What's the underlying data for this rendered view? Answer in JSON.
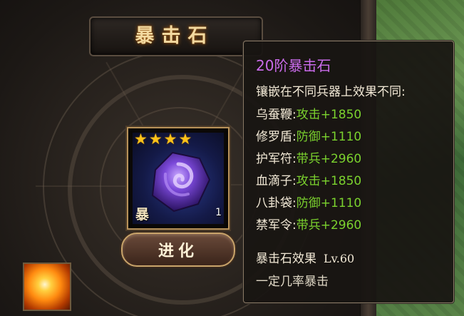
{
  "panel": {
    "title": "暴击石",
    "item": {
      "stars": 4,
      "corner_char": "暴",
      "count": "1",
      "gem_color": "#6a3ac8"
    },
    "evolve_button": "进化",
    "skill_icon": "explosion-icon"
  },
  "tooltip": {
    "title": "20阶暴击石",
    "intro": "镶嵌在不同兵器上效果不同:",
    "effects": [
      {
        "weapon": "乌蚕鞭",
        "stat": "攻击+1850"
      },
      {
        "weapon": "修罗盾",
        "stat": "防御+1110"
      },
      {
        "weapon": "护军符",
        "stat": "带兵+2960"
      },
      {
        "weapon": "血滴子",
        "stat": "攻击+1850"
      },
      {
        "weapon": "八卦袋",
        "stat": "防御+1110"
      },
      {
        "weapon": "禁军令",
        "stat": "带兵+2960"
      }
    ],
    "effect_name": "暴击石效果",
    "level": "Lv.60",
    "effect_desc": "一定几率暴击"
  },
  "colors": {
    "title_purple": "#c96bea",
    "stat_green": "#7bd22e",
    "star_gold": "#ffc21a",
    "frame_gold": "#b8925a"
  }
}
